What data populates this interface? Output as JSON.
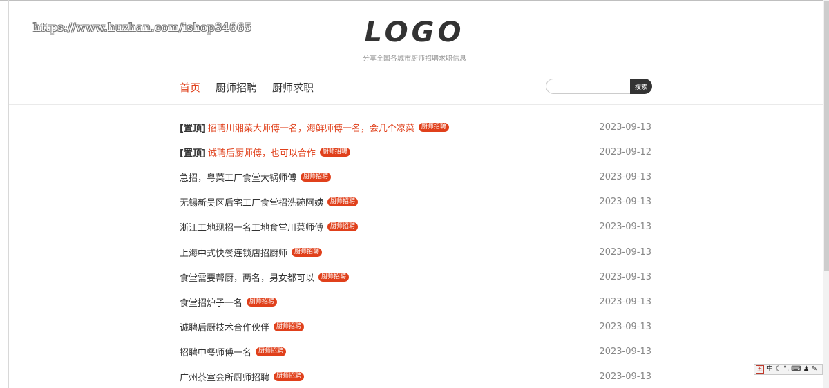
{
  "watermark": "https://www.huzhan.com/ishop34665",
  "header": {
    "logo": "LOGO",
    "tagline": "分享全国各城市厨师招聘求职信息"
  },
  "nav": {
    "items": [
      {
        "label": "首页",
        "active": true
      },
      {
        "label": "厨师招聘",
        "active": false
      },
      {
        "label": "厨师求职",
        "active": false
      }
    ]
  },
  "search": {
    "placeholder": "",
    "button": "搜索"
  },
  "posts": [
    {
      "pin": "[置顶]",
      "title": "招聘川湘菜大师傅一名，海鲜师傅一名，会几个凉菜",
      "tag": "厨师招聘",
      "date": "2023-09-13",
      "hot": true
    },
    {
      "pin": "[置顶]",
      "title": "诚聘后厨师傅，也可以合作",
      "tag": "厨师招聘",
      "date": "2023-09-12",
      "hot": true
    },
    {
      "pin": "",
      "title": "急招，粤菜工厂食堂大锅师傅",
      "tag": "厨师招聘",
      "date": "2023-09-13",
      "hot": false
    },
    {
      "pin": "",
      "title": "无锡新吴区后宅工厂食堂招洗碗阿姨",
      "tag": "厨师招聘",
      "date": "2023-09-13",
      "hot": false
    },
    {
      "pin": "",
      "title": "浙江工地现招一名工地食堂川菜师傅",
      "tag": "厨师招聘",
      "date": "2023-09-13",
      "hot": false
    },
    {
      "pin": "",
      "title": "上海中式快餐连锁店招厨师",
      "tag": "厨师招聘",
      "date": "2023-09-13",
      "hot": false
    },
    {
      "pin": "",
      "title": "食堂需要帮厨，两名，男女都可以",
      "tag": "厨师招聘",
      "date": "2023-09-13",
      "hot": false
    },
    {
      "pin": "",
      "title": "食堂招炉子一名",
      "tag": "厨师招聘",
      "date": "2023-09-13",
      "hot": false
    },
    {
      "pin": "",
      "title": "诚聘后厨技术合作伙伴",
      "tag": "厨师招聘",
      "date": "2023-09-13",
      "hot": false
    },
    {
      "pin": "",
      "title": "招聘中餐师傅一名",
      "tag": "厨师招聘",
      "date": "2023-09-13",
      "hot": false
    },
    {
      "pin": "",
      "title": "广州茶室会所厨师招聘",
      "tag": "厨师招聘",
      "date": "2023-09-13",
      "hot": false
    }
  ],
  "ime": {
    "logo": "五",
    "mode": "中",
    "punct": "°,"
  },
  "colors": {
    "accent": "#e0401b",
    "text": "#333333",
    "date": "#888888"
  }
}
